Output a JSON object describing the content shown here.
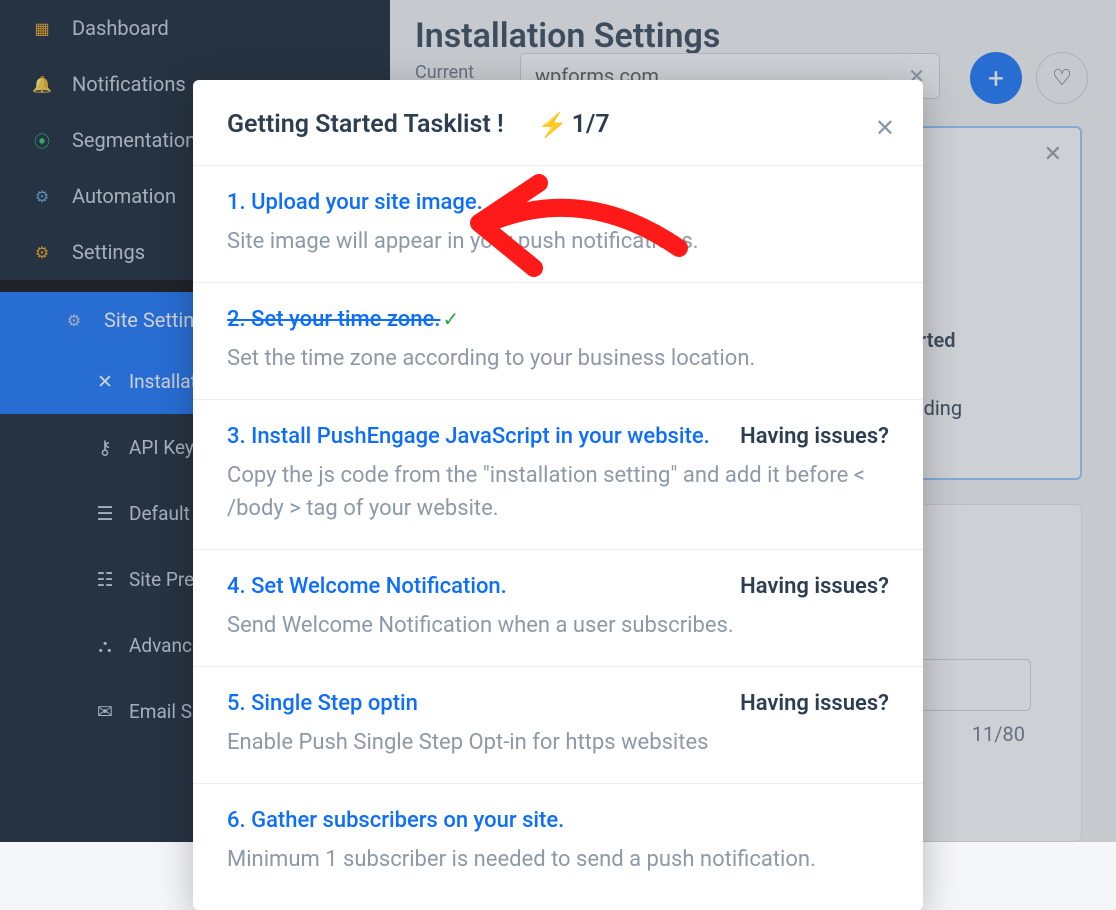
{
  "sidebar": {
    "items": [
      {
        "label": "Dashboard",
        "icon": "dashboard-icon"
      },
      {
        "label": "Notifications",
        "icon": "bell-icon"
      },
      {
        "label": "Segmentation",
        "icon": "segmentation-icon"
      },
      {
        "label": "Automation",
        "icon": "automation-icon"
      },
      {
        "label": "Settings",
        "icon": "settings-icon"
      }
    ],
    "subsection": {
      "label": "Site Settings",
      "icon": "gear-icon"
    },
    "subitems": [
      {
        "label": "Installation",
        "icon": "wrench-icon"
      },
      {
        "label": "API Keys",
        "icon": "key-icon"
      },
      {
        "label": "Default Settings",
        "icon": "sliders-icon"
      },
      {
        "label": "Site Preferences",
        "icon": "preferences-icon"
      },
      {
        "label": "Advanced",
        "icon": "advanced-icon"
      },
      {
        "label": "Email Settings",
        "icon": "email-icon"
      }
    ]
  },
  "header": {
    "title": "Installation Settings",
    "currentLabel": "Current",
    "siteValue": "wpforms.com"
  },
  "panel": {
    "text1": "...rted",
    "text2": "ending"
  },
  "input": {
    "counter": "11/80"
  },
  "modal": {
    "title": "Getting Started Tasklist !",
    "count": "1/7",
    "tasks": [
      {
        "title": "1. Upload your site image.",
        "desc": "Site image will appear in your push notifications.",
        "done": false,
        "issues": false
      },
      {
        "title": "2. Set your time zone.",
        "desc": "Set the time zone according to your business location.",
        "done": true,
        "issues": false
      },
      {
        "title": "3. Install PushEngage JavaScript in your website.",
        "desc": "Copy the js code from the \"installation setting\" and add it before < /body > tag of your website.",
        "done": false,
        "issues": true
      },
      {
        "title": "4. Set Welcome Notification.",
        "desc": "Send Welcome Notification when a user subscribes.",
        "done": false,
        "issues": true
      },
      {
        "title": "5. Single Step optin",
        "desc": "Enable Push Single Step Opt-in for https websites",
        "done": false,
        "issues": true
      },
      {
        "title": "6. Gather subscribers on your site.",
        "desc": "Minimum 1 subscriber is needed to send a push notification.",
        "done": false,
        "issues": false
      }
    ],
    "issuesLabel": "Having issues?"
  }
}
